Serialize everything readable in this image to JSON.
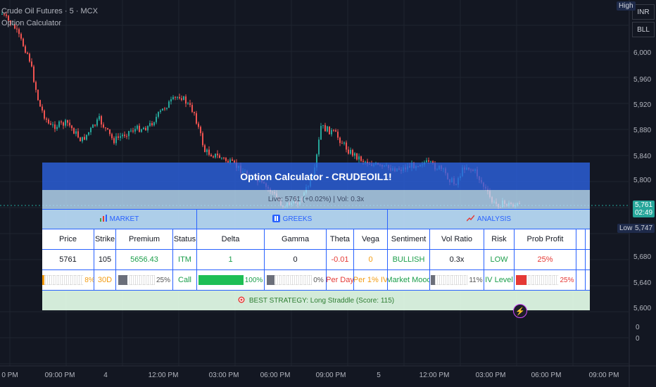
{
  "header": {
    "symbol_line": "Crude Oil Futures · 5 · MCX",
    "indicator_line": "Option Calculator"
  },
  "price_axis": {
    "labels": [
      "6,000",
      "5,960",
      "5,920",
      "5,880",
      "5,840",
      "5,800",
      "5,680",
      "5,640",
      "5,600",
      "0",
      "0"
    ],
    "high_tag": "High",
    "low_tag": "Low",
    "low_value": "5,747",
    "last_price": "5,761",
    "countdown": "02:49",
    "currency": "INR",
    "unit": "BLL"
  },
  "time_axis": {
    "labels": [
      "0 PM",
      "09:00 PM",
      "4",
      "12:00 PM",
      "03:00 PM",
      "06:00 PM",
      "09:00 PM",
      "5",
      "12:00 PM",
      "03:00 PM",
      "06:00 PM",
      "09:00 PM"
    ]
  },
  "calculator": {
    "title": "Option Calculator - CRUDEOIL1!",
    "subtitle": "Live: 5761 (+0.02%) | Vol: 0.3x",
    "sections": {
      "market": "MARKET",
      "greeks": "GREEKS",
      "analysis": "ANALYSIS"
    },
    "headers": [
      "Price",
      "Strike",
      "Premium",
      "Status",
      "Delta",
      "Gamma",
      "Theta",
      "Vega",
      "Sentiment",
      "Vol Ratio",
      "Risk",
      "Prob Profit"
    ],
    "values": {
      "price": "5761",
      "strike": "105",
      "premium": "5656.43",
      "status": "ITM",
      "delta": "1",
      "gamma": "0",
      "theta": "-0.01",
      "vega": "0",
      "sentiment": "BULLISH",
      "vol_ratio": "0.3x",
      "risk": "LOW",
      "prob_profit": "25%"
    },
    "indicators": {
      "price_pct_label": "8%",
      "price_pct": 0.08,
      "days": "30D",
      "premium_pct_label": "25%",
      "premium_pct": 0.25,
      "type": "Call",
      "delta_pct_label": "100%",
      "delta_pct": 1.0,
      "gamma_pct_label": "0%",
      "gamma_pct": 0.0,
      "theta_note": "Per Day",
      "vega_note": "Per 1% IV",
      "sentiment_note": "Market Mood",
      "vol_pct_label": "11%",
      "vol_pct": 0.11,
      "risk_note": "IV Level",
      "prob_pct_label": "25%",
      "prob_pct": 0.25
    },
    "footer": "BEST STRATEGY: Long Straddle (Score: 115)"
  },
  "colors": {
    "up": "#26a69a",
    "down": "#ef5350",
    "accent": "#2962ff",
    "title_bg": "#2d64e6",
    "positive": "#1b9e4b",
    "negative": "#e53935",
    "warning": "#f39c12"
  },
  "icons": [
    "bar-chart-icon",
    "greeks-icon",
    "trend-icon",
    "target-icon",
    "lightning-icon"
  ]
}
